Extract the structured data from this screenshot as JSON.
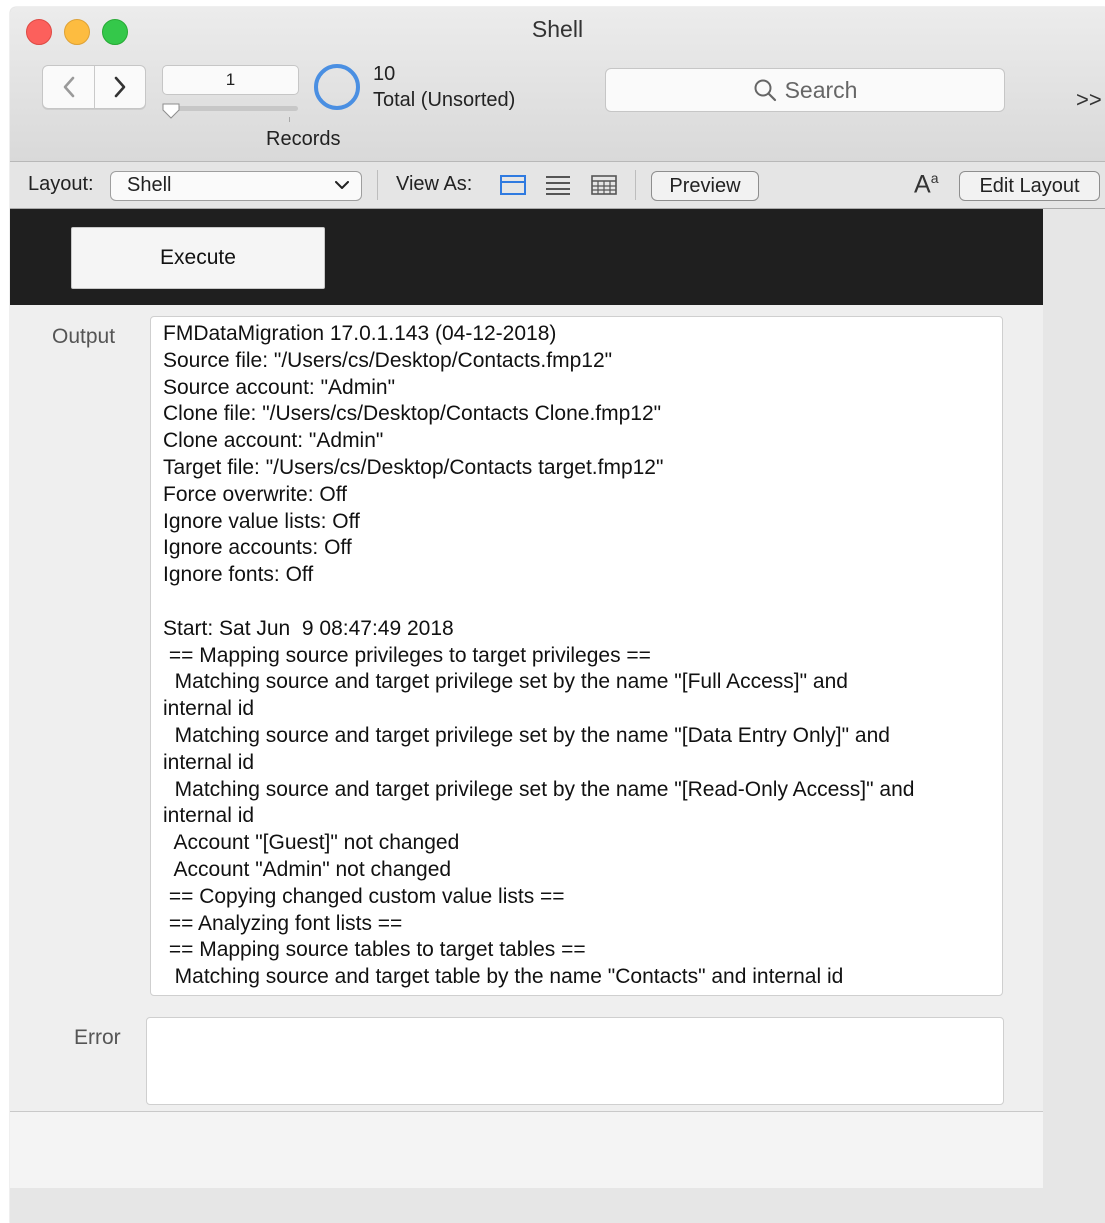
{
  "window": {
    "title": "Shell"
  },
  "toolbar": {
    "record_number": "1",
    "records_label": "Records",
    "found_count": "10",
    "found_state": "Total (Unsorted)",
    "search_placeholder": "Search",
    "overflow_label": ">>"
  },
  "layoutbar": {
    "layout_label": "Layout:",
    "layout_value": "Shell",
    "view_as_label": "View As:",
    "preview_label": "Preview",
    "edit_layout_label": "Edit Layout",
    "font_icon": "A",
    "font_icon_sup": "a"
  },
  "body": {
    "execute_label": "Execute",
    "output_label": "Output",
    "error_label": "Error",
    "output_lines": [
      "FMDataMigration 17.0.1.143 (04-12-2018)",
      "Source file: \"/Users/cs/Desktop/Contacts.fmp12\"",
      "Source account: \"Admin\"",
      "Clone file: \"/Users/cs/Desktop/Contacts Clone.fmp12\"",
      "Clone account: \"Admin\"",
      "Target file: \"/Users/cs/Desktop/Contacts target.fmp12\"",
      "Force overwrite: Off",
      "Ignore value lists: Off",
      "Ignore accounts: Off",
      "Ignore fonts: Off",
      "",
      "Start: Sat Jun  9 08:47:49 2018",
      " == Mapping source privileges to target privileges ==",
      "  Matching source and target privilege set by the name \"[Full Access]\" and",
      "internal id",
      "  Matching source and target privilege set by the name \"[Data Entry Only]\" and",
      "internal id",
      "  Matching source and target privilege set by the name \"[Read-Only Access]\" and",
      "internal id",
      "  Account \"[Guest]\" not changed",
      "  Account \"Admin\" not changed",
      " == Copying changed custom value lists ==",
      " == Analyzing font lists ==",
      " == Mapping source tables to target tables ==",
      "  Matching source and target table by the name \"Contacts\" and internal id"
    ]
  },
  "icons": {
    "close": "close-button-icon",
    "minimize": "minimize-button-icon",
    "zoom": "zoom-button-icon",
    "prev": "chevron-left-icon",
    "next": "chevron-right-icon",
    "search": "magnifier-icon",
    "form_view": "form-view-icon",
    "list_view": "list-view-icon",
    "table_view": "table-view-icon",
    "pie": "record-pie-icon"
  },
  "colors": {
    "close": "#fc605c",
    "minimize": "#fdbc40",
    "zoom": "#34c84a",
    "accent": "#4a8fe2",
    "header_band": "#1f1f1f"
  }
}
